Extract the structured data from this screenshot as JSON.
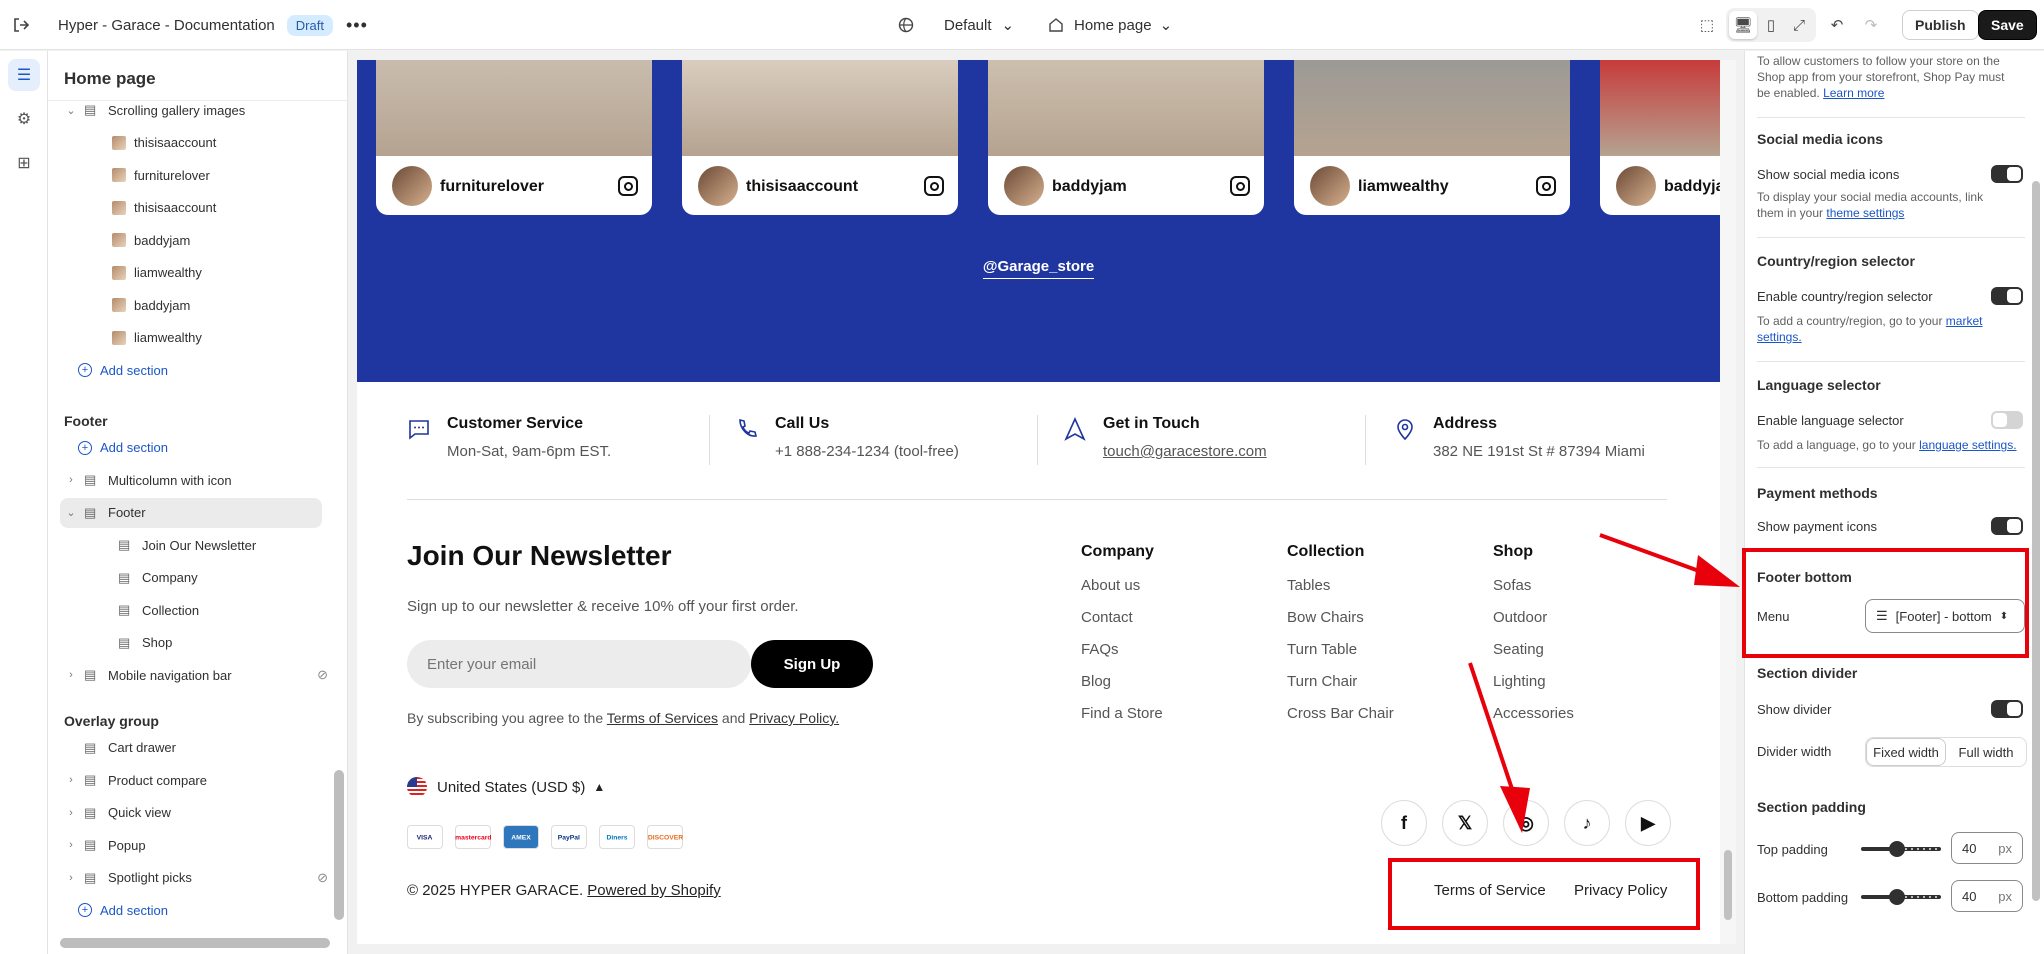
{
  "topbar": {
    "store_title": "Hyper - Garace - Documentation",
    "status_badge": "Draft",
    "theme_selector": "Default",
    "page_selector": "Home page",
    "publish_label": "Publish",
    "save_label": "Save"
  },
  "sidebar": {
    "title": "Home page",
    "items": [
      {
        "label": "Scrolling gallery images",
        "level": 1,
        "chevron": "down"
      },
      {
        "label": "thisisaaccount",
        "level": 2
      },
      {
        "label": "furniturelover",
        "level": 2
      },
      {
        "label": "thisisaaccount",
        "level": 2
      },
      {
        "label": "baddyjam",
        "level": 2
      },
      {
        "label": "liamwealthy",
        "level": 2
      },
      {
        "label": "baddyjam",
        "level": 2
      },
      {
        "label": "liamwealthy",
        "level": 2
      },
      {
        "label": "Add section",
        "type": "add"
      }
    ],
    "footer_group": {
      "title": "Footer",
      "items": [
        {
          "label": "Add section",
          "type": "add"
        },
        {
          "label": "Multicolumn with icon",
          "chevron": "right"
        },
        {
          "label": "Footer",
          "chevron": "down",
          "selected": true
        },
        {
          "label": "Join Our Newsletter",
          "level": 2
        },
        {
          "label": "Company",
          "level": 2
        },
        {
          "label": "Collection",
          "level": 2
        },
        {
          "label": "Shop",
          "level": 2
        },
        {
          "label": "Mobile navigation bar",
          "chevron": "right",
          "hidden": true
        }
      ]
    },
    "overlay_group": {
      "title": "Overlay group",
      "items": [
        {
          "label": "Cart drawer"
        },
        {
          "label": "Product compare",
          "chevron": "right"
        },
        {
          "label": "Quick view",
          "chevron": "right"
        },
        {
          "label": "Popup",
          "chevron": "right"
        },
        {
          "label": "Spotlight picks",
          "chevron": "right",
          "hidden": true
        },
        {
          "label": "Add section",
          "type": "add"
        }
      ]
    }
  },
  "preview": {
    "gallery_cards": [
      "furniturelover",
      "thisisaaccount",
      "baddyjam",
      "liamwealthy",
      "baddyja"
    ],
    "handle": "@Garage_store",
    "services": [
      {
        "title": "Customer Service",
        "desc": "Mon-Sat, 9am-6pm EST."
      },
      {
        "title": "Call Us",
        "desc": "+1 888-234-1234 (tool-free)"
      },
      {
        "title": "Get in Touch",
        "desc": "touch@garacestore.com"
      },
      {
        "title": "Address",
        "desc": "382 NE 191st St # 87394 Miami"
      }
    ],
    "newsletter": {
      "title": "Join Our Newsletter",
      "subtitle": "Sign up to our newsletter & receive 10% off your first order.",
      "email_placeholder": "Enter your email",
      "signup_label": "Sign Up",
      "agree_prefix": "By subscribing you agree to the",
      "terms_link": "Terms of Services",
      "and_text": "and",
      "privacy_link": "Privacy Policy."
    },
    "columns": [
      {
        "title": "Company",
        "links": [
          "About us",
          "Contact",
          "FAQs",
          "Blog",
          "Find a Store"
        ]
      },
      {
        "title": "Collection",
        "links": [
          "Tables",
          "Bow Chairs",
          "Turn Table",
          "Turn Chair",
          "Cross Bar Chair"
        ]
      },
      {
        "title": "Shop",
        "links": [
          "Sofas",
          "Outdoor",
          "Seating",
          "Lighting",
          "Accessories"
        ]
      }
    ],
    "currency": "United States (USD $)",
    "payment_icons": [
      "VISA",
      "mastercard",
      "AMEX",
      "PayPal",
      "Diners",
      "DISCOVER"
    ],
    "social_icons": [
      "f",
      "X",
      "instagram",
      "tiktok",
      "youtube"
    ],
    "copyright": "© 2025 HYPER GARACE.",
    "powered_by": "Powered by Shopify",
    "legal_links": [
      "Terms of Service",
      "Privacy Policy"
    ]
  },
  "settings": {
    "shop_pay_help": "To allow customers to follow your store on the Shop app from your storefront, Shop Pay must be enabled.",
    "learn_more": "Learn more",
    "social_title": "Social media icons",
    "social_label": "Show social media icons",
    "social_help": "To display your social media accounts, link them in your",
    "social_link": "theme settings",
    "country_title": "Country/region selector",
    "country_label": "Enable country/region selector",
    "country_help": "To add a country/region, go to your",
    "country_link": "market settings.",
    "language_title": "Language selector",
    "language_label": "Enable language selector",
    "language_help": "To add a language, go to your",
    "language_link": "language settings.",
    "payment_title": "Payment methods",
    "payment_label": "Show payment icons",
    "footer_bottom_title": "Footer bottom",
    "menu_label": "Menu",
    "menu_value": "[Footer] - bottom",
    "divider_title": "Section divider",
    "divider_label": "Show divider",
    "divider_width_label": "Divider width",
    "divider_options": [
      "Fixed width",
      "Full width"
    ],
    "padding_title": "Section padding",
    "top_padding_label": "Top padding",
    "top_padding_value": "40",
    "bottom_padding_label": "Bottom padding",
    "bottom_padding_value": "40",
    "unit": "px",
    "toggles": {
      "social": true,
      "country": true,
      "language": false,
      "payment": true,
      "divider": true
    }
  }
}
